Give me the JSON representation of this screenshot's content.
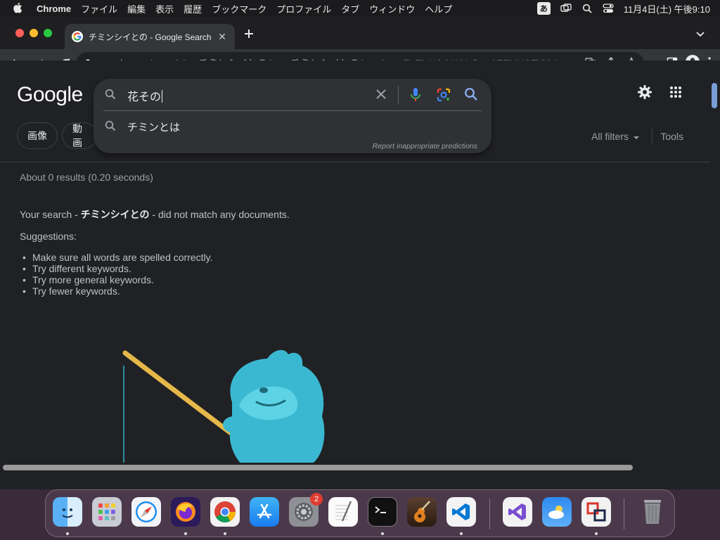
{
  "menubar": {
    "app": "Chrome",
    "items": [
      "ファイル",
      "編集",
      "表示",
      "履歴",
      "ブックマーク",
      "プロファイル",
      "タブ",
      "ウィンドウ",
      "ヘルプ"
    ],
    "ime": "あ",
    "datetime": "11月4日(土) 午後9:10"
  },
  "tab": {
    "title": "チミンシイとの - Google Search",
    "close": "✕"
  },
  "toolbar": {
    "url_host": "google.com",
    "url_rest": "/search?q=チミンシイとの&oq=チミンシイとの&gs_lcrp=EgZjaHJvbWUyBggAEEUYOTIJCA..."
  },
  "page": {
    "logo": "Google",
    "search": {
      "query": "花その",
      "suggestion": "チミンとは",
      "report": "Report inappropriate predictions"
    },
    "chips": [
      "画像",
      "動画"
    ],
    "all_filters": "All filters",
    "tools": "Tools",
    "stats": "About 0 results (0.20 seconds)",
    "nomatch_prefix": "Your search - ",
    "nomatch_query": "チミンシイとの",
    "nomatch_suffix": " - did not match any documents.",
    "suggestions_title": "Suggestions:",
    "suggestions": [
      "Make sure all words are spelled correctly.",
      "Try different keywords.",
      "Try more general keywords.",
      "Try fewer keywords."
    ]
  },
  "dock": {
    "apps": [
      "finder-icon",
      "launchpad-icon",
      "safari-icon",
      "firefox-icon",
      "chrome-icon",
      "app-store-icon",
      "system-settings-icon",
      "textedit-icon",
      "terminal-icon",
      "garageband-icon",
      "vscode-icon",
      "visual-studio-icon",
      "weather-icon",
      "parallels-icon",
      "trash-icon"
    ],
    "settings_badge": "2"
  },
  "colors": {
    "accent": "#8ab4f8",
    "page_bg": "#202124",
    "searchbox_bg": "#303134"
  }
}
